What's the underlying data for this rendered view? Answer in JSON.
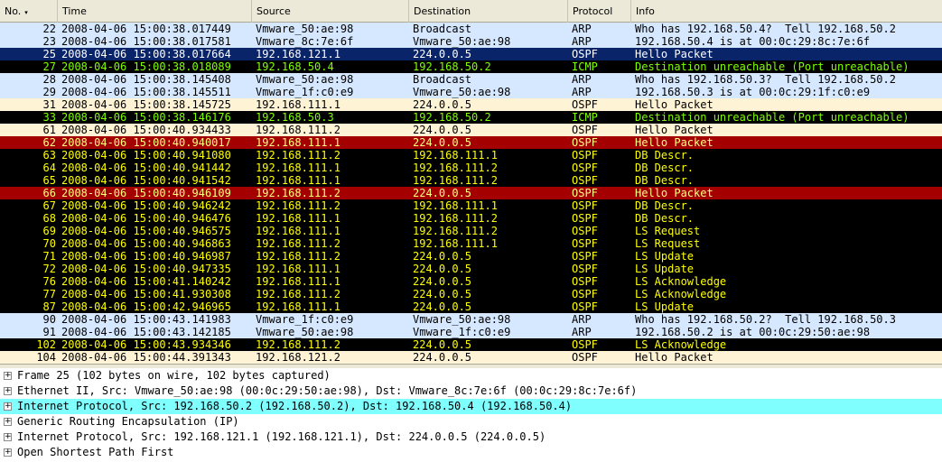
{
  "columns": [
    {
      "key": "no",
      "label": "No.",
      "sorted": true
    },
    {
      "key": "time",
      "label": "Time"
    },
    {
      "key": "source",
      "label": "Source"
    },
    {
      "key": "destination",
      "label": "Destination"
    },
    {
      "key": "protocol",
      "label": "Protocol"
    },
    {
      "key": "info",
      "label": "Info"
    }
  ],
  "sort_indicator": "▾",
  "color_styles": {
    "arp": {
      "bg": "#d6e8ff",
      "fg": "#000000"
    },
    "icmp": {
      "bg": "#000000",
      "fg": "#7fff00"
    },
    "ospf_hello": {
      "bg": "#fff3d6",
      "fg": "#000000"
    },
    "ospf_black": {
      "bg": "#000000",
      "fg": "#ffff00"
    },
    "ospf_red": {
      "bg": "#a40000",
      "fg": "#ffff80"
    },
    "selected": {
      "bg": "#0a246a",
      "fg": "#ffffff"
    }
  },
  "packets": [
    {
      "no": "22",
      "time": "2008-04-06 15:00:38.017449",
      "source": "Vmware_50:ae:98",
      "destination": "Broadcast",
      "protocol": "ARP",
      "info": "Who has 192.168.50.4?  Tell 192.168.50.2",
      "style": "arp"
    },
    {
      "no": "23",
      "time": "2008-04-06 15:00:38.017581",
      "source": "Vmware_8c:7e:6f",
      "destination": "Vmware_50:ae:98",
      "protocol": "ARP",
      "info": "192.168.50.4 is at 00:0c:29:8c:7e:6f",
      "style": "arp"
    },
    {
      "no": "25",
      "time": "2008-04-06 15:00:38.017664",
      "source": "192.168.121.1",
      "destination": "224.0.0.5",
      "protocol": "OSPF",
      "info": "Hello Packet",
      "style": "selected"
    },
    {
      "no": "27",
      "time": "2008-04-06 15:00:38.018089",
      "source": "192.168.50.4",
      "destination": "192.168.50.2",
      "protocol": "ICMP",
      "info": "Destination unreachable (Port unreachable)",
      "style": "icmp"
    },
    {
      "no": "28",
      "time": "2008-04-06 15:00:38.145408",
      "source": "Vmware_50:ae:98",
      "destination": "Broadcast",
      "protocol": "ARP",
      "info": "Who has 192.168.50.3?  Tell 192.168.50.2",
      "style": "arp"
    },
    {
      "no": "29",
      "time": "2008-04-06 15:00:38.145511",
      "source": "Vmware_1f:c0:e9",
      "destination": "Vmware_50:ae:98",
      "protocol": "ARP",
      "info": "192.168.50.3 is at 00:0c:29:1f:c0:e9",
      "style": "arp"
    },
    {
      "no": "31",
      "time": "2008-04-06 15:00:38.145725",
      "source": "192.168.111.1",
      "destination": "224.0.0.5",
      "protocol": "OSPF",
      "info": "Hello Packet",
      "style": "ospf_hello"
    },
    {
      "no": "33",
      "time": "2008-04-06 15:00:38.146176",
      "source": "192.168.50.3",
      "destination": "192.168.50.2",
      "protocol": "ICMP",
      "info": "Destination unreachable (Port unreachable)",
      "style": "icmp"
    },
    {
      "no": "61",
      "time": "2008-04-06 15:00:40.934433",
      "source": "192.168.111.2",
      "destination": "224.0.0.5",
      "protocol": "OSPF",
      "info": "Hello Packet",
      "style": "ospf_hello"
    },
    {
      "no": "62",
      "time": "2008-04-06 15:00:40.940017",
      "source": "192.168.111.1",
      "destination": "224.0.0.5",
      "protocol": "OSPF",
      "info": "Hello Packet",
      "style": "ospf_red"
    },
    {
      "no": "63",
      "time": "2008-04-06 15:00:40.941080",
      "source": "192.168.111.2",
      "destination": "192.168.111.1",
      "protocol": "OSPF",
      "info": "DB Descr.",
      "style": "ospf_black"
    },
    {
      "no": "64",
      "time": "2008-04-06 15:00:40.941442",
      "source": "192.168.111.1",
      "destination": "192.168.111.2",
      "protocol": "OSPF",
      "info": "DB Descr.",
      "style": "ospf_black"
    },
    {
      "no": "65",
      "time": "2008-04-06 15:00:40.941542",
      "source": "192.168.111.1",
      "destination": "192.168.111.2",
      "protocol": "OSPF",
      "info": "DB Descr.",
      "style": "ospf_black"
    },
    {
      "no": "66",
      "time": "2008-04-06 15:00:40.946109",
      "source": "192.168.111.2",
      "destination": "224.0.0.5",
      "protocol": "OSPF",
      "info": "Hello Packet",
      "style": "ospf_red"
    },
    {
      "no": "67",
      "time": "2008-04-06 15:00:40.946242",
      "source": "192.168.111.2",
      "destination": "192.168.111.1",
      "protocol": "OSPF",
      "info": "DB Descr.",
      "style": "ospf_black"
    },
    {
      "no": "68",
      "time": "2008-04-06 15:00:40.946476",
      "source": "192.168.111.1",
      "destination": "192.168.111.2",
      "protocol": "OSPF",
      "info": "DB Descr.",
      "style": "ospf_black"
    },
    {
      "no": "69",
      "time": "2008-04-06 15:00:40.946575",
      "source": "192.168.111.1",
      "destination": "192.168.111.2",
      "protocol": "OSPF",
      "info": "LS Request",
      "style": "ospf_black"
    },
    {
      "no": "70",
      "time": "2008-04-06 15:00:40.946863",
      "source": "192.168.111.2",
      "destination": "192.168.111.1",
      "protocol": "OSPF",
      "info": "LS Request",
      "style": "ospf_black"
    },
    {
      "no": "71",
      "time": "2008-04-06 15:00:40.946987",
      "source": "192.168.111.2",
      "destination": "224.0.0.5",
      "protocol": "OSPF",
      "info": "LS Update",
      "style": "ospf_black"
    },
    {
      "no": "72",
      "time": "2008-04-06 15:00:40.947335",
      "source": "192.168.111.1",
      "destination": "224.0.0.5",
      "protocol": "OSPF",
      "info": "LS Update",
      "style": "ospf_black"
    },
    {
      "no": "76",
      "time": "2008-04-06 15:00:41.140242",
      "source": "192.168.111.1",
      "destination": "224.0.0.5",
      "protocol": "OSPF",
      "info": "LS Acknowledge",
      "style": "ospf_black"
    },
    {
      "no": "77",
      "time": "2008-04-06 15:00:41.930308",
      "source": "192.168.111.2",
      "destination": "224.0.0.5",
      "protocol": "OSPF",
      "info": "LS Acknowledge",
      "style": "ospf_black"
    },
    {
      "no": "87",
      "time": "2008-04-06 15:00:42.946965",
      "source": "192.168.111.1",
      "destination": "224.0.0.5",
      "protocol": "OSPF",
      "info": "LS Update",
      "style": "ospf_black"
    },
    {
      "no": "90",
      "time": "2008-04-06 15:00:43.141983",
      "source": "Vmware_1f:c0:e9",
      "destination": "Vmware_50:ae:98",
      "protocol": "ARP",
      "info": "Who has 192.168.50.2?  Tell 192.168.50.3",
      "style": "arp"
    },
    {
      "no": "91",
      "time": "2008-04-06 15:00:43.142185",
      "source": "Vmware_50:ae:98",
      "destination": "Vmware_1f:c0:e9",
      "protocol": "ARP",
      "info": "192.168.50.2 is at 00:0c:29:50:ae:98",
      "style": "arp"
    },
    {
      "no": "102",
      "time": "2008-04-06 15:00:43.934346",
      "source": "192.168.111.2",
      "destination": "224.0.0.5",
      "protocol": "OSPF",
      "info": "LS Acknowledge",
      "style": "ospf_black"
    },
    {
      "no": "104",
      "time": "2008-04-06 15:00:44.391343",
      "source": "192.168.121.2",
      "destination": "224.0.0.5",
      "protocol": "OSPF",
      "info": "Hello Packet",
      "style": "ospf_hello"
    }
  ],
  "details": [
    {
      "text": "Frame 25 (102 bytes on wire, 102 bytes captured)",
      "bg": "#ffffff"
    },
    {
      "text": "Ethernet II, Src: Vmware_50:ae:98 (00:0c:29:50:ae:98), Dst: Vmware_8c:7e:6f (00:0c:29:8c:7e:6f)",
      "bg": "#ffffff"
    },
    {
      "text": "Internet Protocol, Src: 192.168.50.2 (192.168.50.2), Dst: 192.168.50.4 (192.168.50.4)",
      "bg": "#80ffff"
    },
    {
      "text": "Generic Routing Encapsulation (IP)",
      "bg": "#ffffff"
    },
    {
      "text": "Internet Protocol, Src: 192.168.121.1 (192.168.121.1), Dst: 224.0.0.5 (224.0.0.5)",
      "bg": "#ffffff"
    },
    {
      "text": "Open Shortest Path First",
      "bg": "#ffffff"
    }
  ],
  "expander_glyph": "+"
}
